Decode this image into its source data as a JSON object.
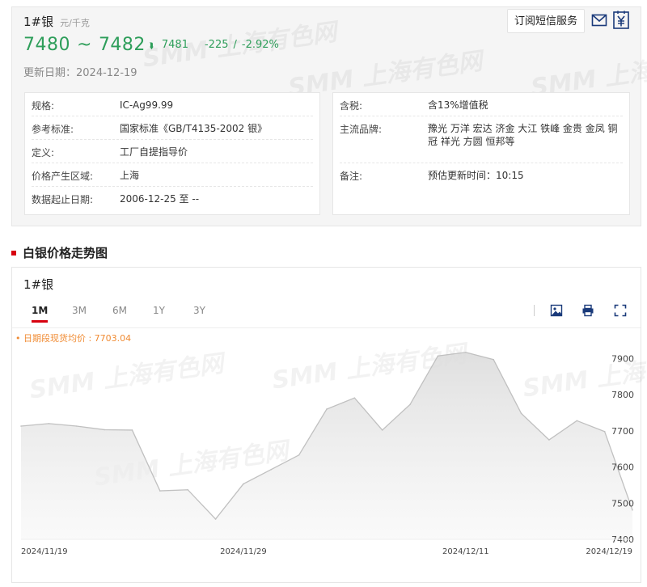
{
  "header": {
    "product_name": "1#银",
    "unit": "元/千克",
    "price_low": "7480",
    "price_sep": "~",
    "price_high": "7482",
    "avg_price": "7481",
    "change": "-225",
    "change_sep": "/",
    "change_pct": "-2.92%",
    "update_label": "更新日期：",
    "update_date": "2024-12-19",
    "subscribe_label": "订阅短信服务",
    "mail_icon": "mail-icon",
    "doc_icon": "yuan-document-icon",
    "price_color": "#2e9e5a"
  },
  "watermark_text": "SMM 上海有色网",
  "specs_left": [
    {
      "label": "规格:",
      "value": "IC-Ag99.99"
    },
    {
      "label": "参考标准:",
      "value": "国家标准《GB/T4135-2002 银》"
    },
    {
      "label": "定义:",
      "value": "工厂自提指导价"
    },
    {
      "label": "价格产生区域:",
      "value": "上海"
    },
    {
      "label": "数据起止日期:",
      "value": "2006-12-25 至 --"
    }
  ],
  "specs_right": [
    {
      "label": "含税:",
      "value": "含13%增值税"
    },
    {
      "label": "主流品牌:",
      "value": "豫光 万洋 宏达 济金 大江 铁峰 金贵 金凤 铜冠 祥光 方圆 恒邦等"
    },
    {
      "label": "备注:",
      "value": "预估更新时间：10:15"
    }
  ],
  "section_title": "白银价格走势图",
  "chart_card": {
    "name": "1#银",
    "tabs": [
      "1M",
      "3M",
      "6M",
      "1Y",
      "3Y"
    ],
    "active_tab": "1M",
    "avg_label": "• 日期段现货均价 : 7703.04",
    "tool_icons": [
      "save-image-icon",
      "print-icon",
      "fullscreen-icon"
    ],
    "accent_color": "#d7000f"
  },
  "chart_data": {
    "type": "area",
    "title": "",
    "x": [
      "2024/11/19",
      "2024/11/20",
      "2024/11/21",
      "2024/11/22",
      "2024/11/25",
      "2024/11/26",
      "2024/11/27",
      "2024/11/28",
      "2024/11/29",
      "2024/12/02",
      "2024/12/03",
      "2024/12/04",
      "2024/12/05",
      "2024/12/06",
      "2024/12/09",
      "2024/12/10",
      "2024/12/11",
      "2024/12/12",
      "2024/12/13",
      "2024/12/16",
      "2024/12/17",
      "2024/12/18",
      "2024/12/19"
    ],
    "series": [
      {
        "values": [
          7713,
          7720,
          7713,
          7703,
          7702,
          7534,
          7537,
          7456,
          7553,
          7593,
          7633,
          7760,
          7791,
          7702,
          7773,
          7907,
          7917,
          7897,
          7748,
          7675,
          7728,
          7698,
          7481
        ]
      }
    ],
    "x_tick_labels": [
      "2024/11/19",
      "2024/11/29",
      "2024/12/11",
      "2024/12/19"
    ],
    "y_ticks": [
      7400,
      7500,
      7600,
      7700,
      7800,
      7900
    ],
    "ylim": [
      7400,
      7950
    ],
    "y_axis_position": "right",
    "grid": false,
    "line_color": "#c8c8c8",
    "fill_color": "#e8e8e8"
  }
}
